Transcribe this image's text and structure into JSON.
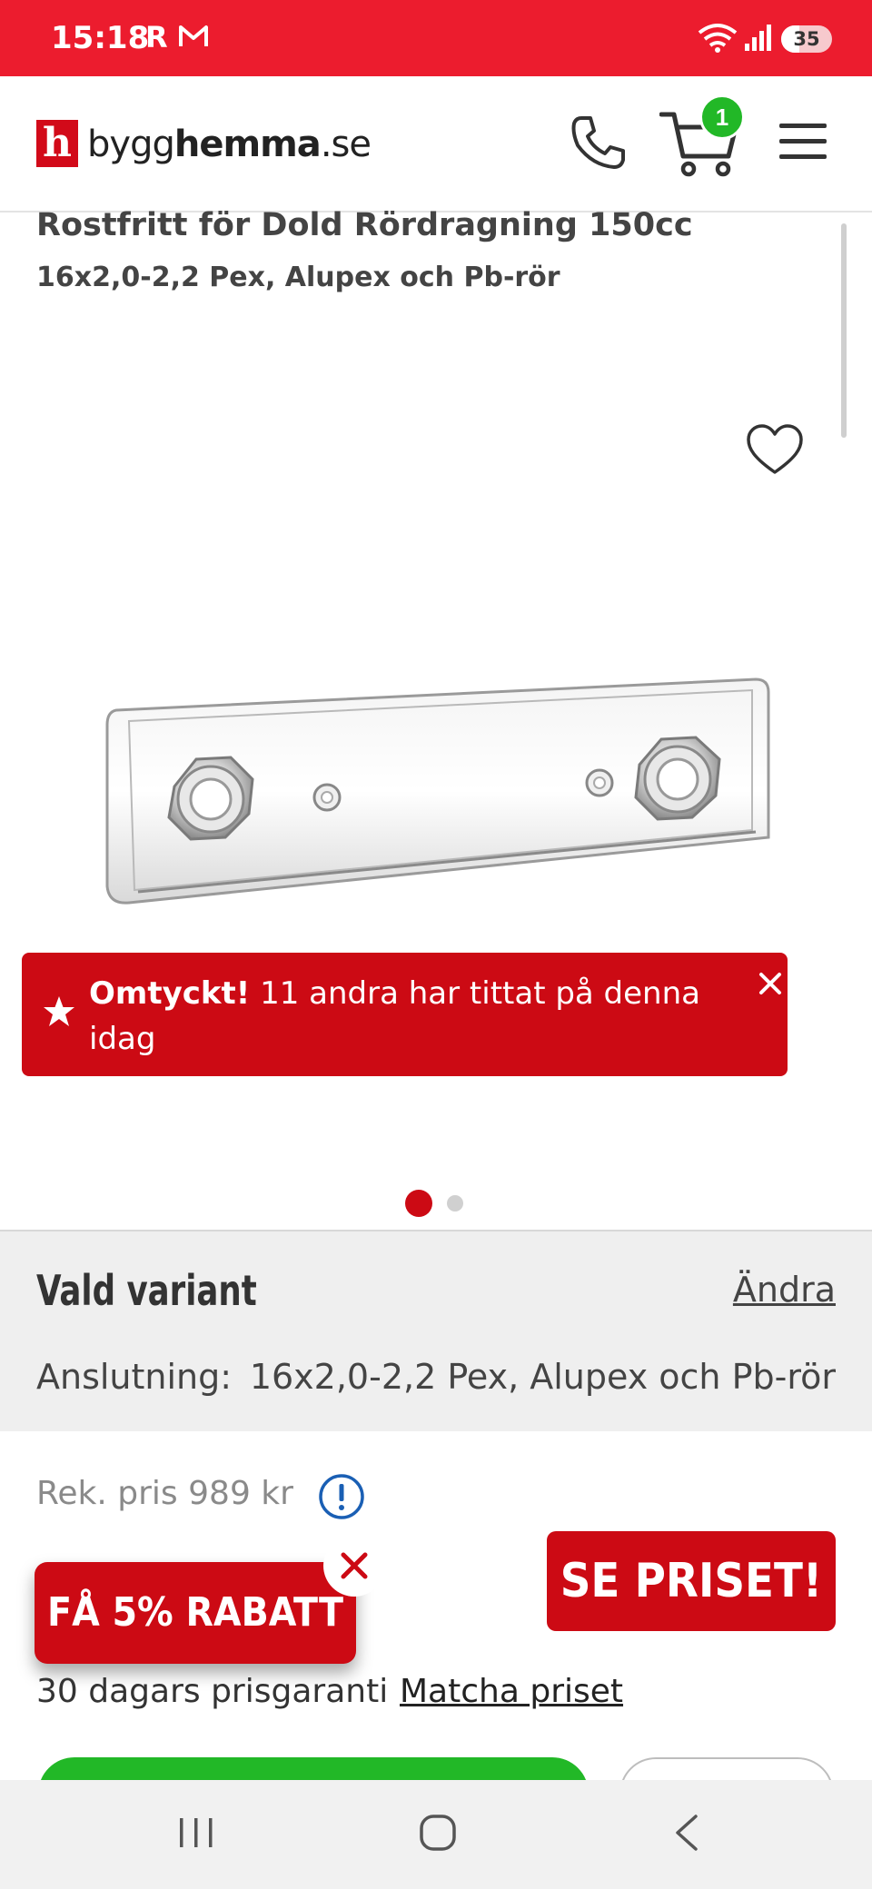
{
  "status_bar": {
    "time": "15:18",
    "carrier_glyph": "R",
    "battery": "35",
    "battery_level": 0.35,
    "icons": [
      "mail-icon",
      "wifi-icon",
      "signal-icon",
      "battery-icon"
    ]
  },
  "header": {
    "logo_letter": "h",
    "logo_light": "bygg",
    "logo_bold": "hemma",
    "logo_suffix": ".se",
    "cart_count": "1",
    "icons": [
      "phone-icon",
      "cart-icon",
      "menu-icon"
    ]
  },
  "product": {
    "title": "Rostfritt för Dold Rördragning 150cc",
    "subtitle": "16x2,0-2,2 Pex, Alupex och Pb-rör"
  },
  "banner": {
    "bold": "Omtyckt!",
    "text": " 11 andra har tittat på denna idag"
  },
  "carousel": {
    "active_index": 1,
    "total": 2
  },
  "variant": {
    "heading": "Vald variant",
    "change_link": "Ändra",
    "label": "Anslutning:",
    "value": "16x2,0-2,2 Pex, Alupex och Pb-rör"
  },
  "pricing": {
    "recommended": "Rek. pris 989 kr",
    "see_price_button": "SE PRISET!",
    "discount_button": "FÅ 5% RABATT",
    "guarantee": "30 dagars prisgaranti",
    "match_link": "Matcha priset"
  },
  "colors": {
    "brand_red": "#cc0a14",
    "status_red": "#ec1c2e",
    "cta_green": "#22b827"
  }
}
